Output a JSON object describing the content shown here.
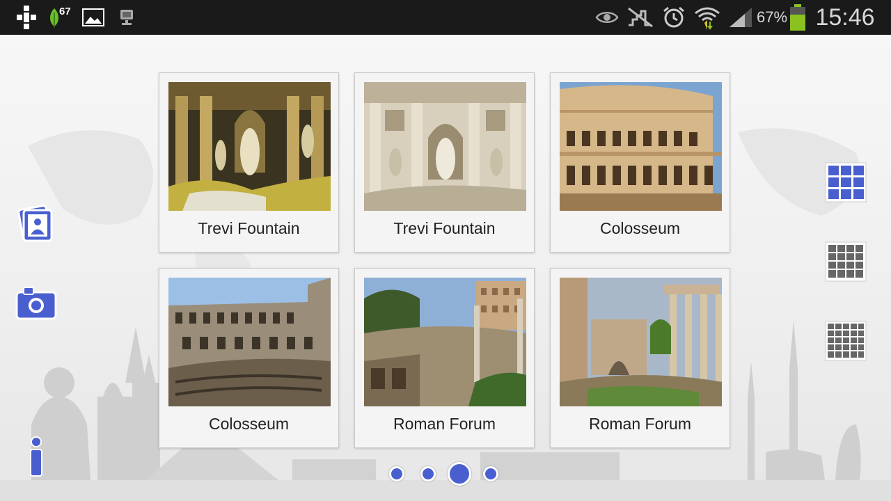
{
  "status_bar": {
    "notification_count": "67",
    "battery_percent": "67%",
    "clock": "15:46",
    "icons": [
      "usb-icon",
      "leaf-icon",
      "image-icon",
      "sync-icon",
      "eye-icon",
      "no-signal-icon",
      "alarm-icon",
      "wifi-icon",
      "cell-signal-icon",
      "battery-icon"
    ]
  },
  "gallery": {
    "items": [
      {
        "label": "Trevi Fountain"
      },
      {
        "label": "Trevi Fountain"
      },
      {
        "label": "Colosseum"
      },
      {
        "label": "Colosseum"
      },
      {
        "label": "Roman Forum"
      },
      {
        "label": "Roman Forum"
      }
    ]
  },
  "left_toolbar": [
    "photo-album-icon",
    "camera-icon",
    "info-icon"
  ],
  "right_toolbar": [
    "grid-3x3-icon",
    "grid-4x4-icon",
    "grid-5x5-icon"
  ],
  "pager": {
    "page_count": 4,
    "current_page": 3
  },
  "colors": {
    "accent": "#4a5fcf",
    "status_bar": "#1a1a1a",
    "battery_fill": "#8bc21f"
  }
}
